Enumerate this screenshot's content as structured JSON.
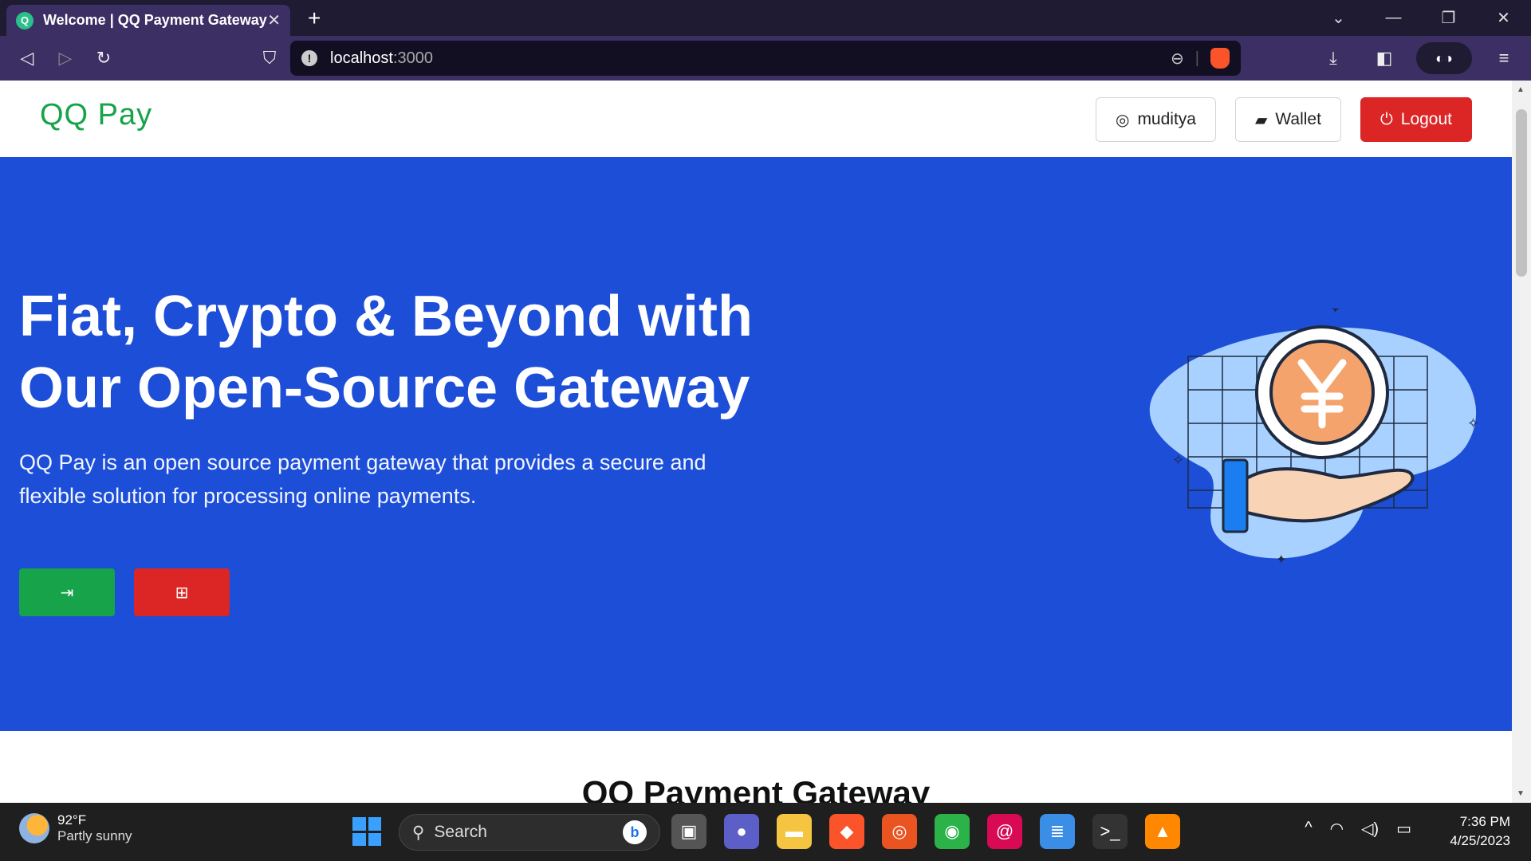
{
  "browser": {
    "tab_title": "Welcome | QQ Payment Gateway",
    "url_host": "localhost",
    "url_port": ":3000"
  },
  "navbar": {
    "logo": "QQ Pay",
    "user_label": "muditya",
    "wallet_label": "Wallet",
    "logout_label": "Logout"
  },
  "hero": {
    "title": "Fiat, Crypto & Beyond with Our Open-Source Gateway",
    "subtitle": "QQ Pay is an open source payment gateway that provides a secure and flexible solution for processing online payments.",
    "accent_green": "#16a34a",
    "accent_red": "#dc2626",
    "background": "#1d4ed8"
  },
  "section": {
    "title": "QQ Payment Gateway"
  },
  "taskbar": {
    "weather_temp": "92°F",
    "weather_desc": "Partly sunny",
    "search_placeholder": "Search",
    "time": "7:36 PM",
    "date": "4/25/2023"
  }
}
